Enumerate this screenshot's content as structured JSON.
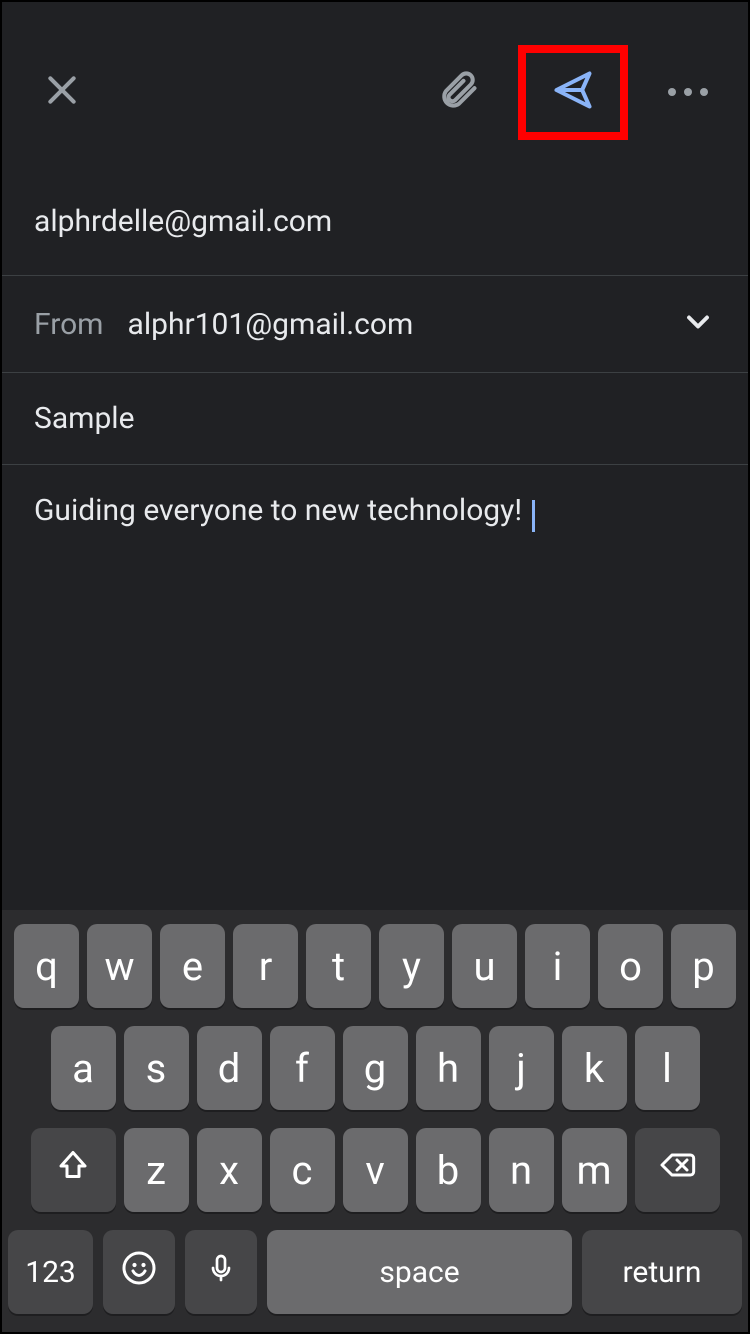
{
  "colors": {
    "accent": "#8ab4f8",
    "highlight_box": "#ff0000",
    "icon_gray": "#9aa0a6"
  },
  "compose": {
    "to": "alphrdelle@gmail.com",
    "from_label": "From",
    "from": "alphr101@gmail.com",
    "subject": "Sample",
    "body": "Guiding everyone to new technology! "
  },
  "keyboard": {
    "row1": [
      "q",
      "w",
      "e",
      "r",
      "t",
      "y",
      "u",
      "i",
      "o",
      "p"
    ],
    "row2": [
      "a",
      "s",
      "d",
      "f",
      "g",
      "h",
      "j",
      "k",
      "l"
    ],
    "row3": [
      "z",
      "x",
      "c",
      "v",
      "b",
      "n",
      "m"
    ],
    "numbers": "123",
    "space": "space",
    "return": "return"
  }
}
